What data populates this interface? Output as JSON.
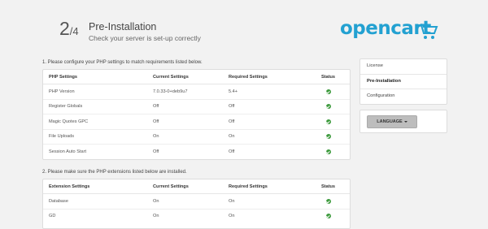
{
  "header": {
    "step_current": "2",
    "step_total": "4",
    "title": "Pre-Installation",
    "subtitle": "Check your server is set-up correctly",
    "logo_text": "opencart",
    "brand_color": "#23a1d1"
  },
  "section1": {
    "label": "1. Please configure your PHP settings to match requirements listed below.",
    "headers": [
      "PHP Settings",
      "Current Settings",
      "Required Settings",
      "Status"
    ],
    "rows": [
      {
        "setting": "PHP Version",
        "current": "7.0.33-0+deb9u7",
        "required": "5.4+",
        "status": "ok"
      },
      {
        "setting": "Register Globals",
        "current": "Off",
        "required": "Off",
        "status": "ok"
      },
      {
        "setting": "Magic Quotes GPC",
        "current": "Off",
        "required": "Off",
        "status": "ok"
      },
      {
        "setting": "File Uploads",
        "current": "On",
        "required": "On",
        "status": "ok"
      },
      {
        "setting": "Session Auto Start",
        "current": "Off",
        "required": "Off",
        "status": "ok"
      }
    ]
  },
  "section2": {
    "label": "2. Please make sure the PHP extensions listed below are installed.",
    "headers": [
      "Extension Settings",
      "Current Settings",
      "Required Settings",
      "Status"
    ],
    "rows": [
      {
        "setting": "Database",
        "current": "On",
        "required": "On",
        "status": "ok"
      },
      {
        "setting": "GD",
        "current": "On",
        "required": "On",
        "status": "ok"
      }
    ]
  },
  "sidebar": {
    "items": [
      {
        "label": "License",
        "active": false
      },
      {
        "label": "Pre-Installation",
        "active": true
      },
      {
        "label": "Configuration",
        "active": false
      }
    ]
  },
  "language": {
    "button_label": "LANGUAGE"
  },
  "icons": {
    "status_ok": "check-circle-icon",
    "cart": "cart-icon",
    "caret": "caret-down-icon"
  },
  "colors": {
    "status_ok": "#3c9a3c",
    "background": "#f2f2f2"
  }
}
